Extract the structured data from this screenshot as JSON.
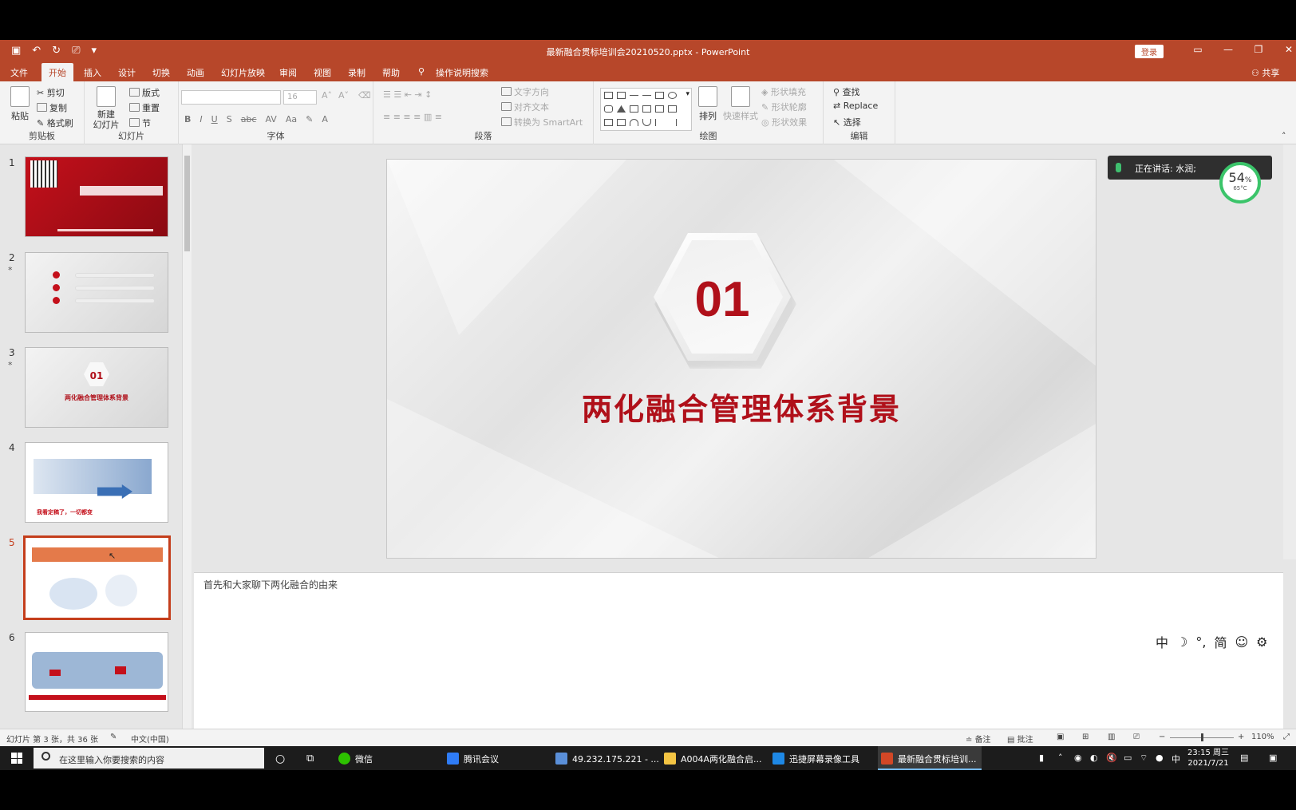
{
  "app": {
    "doc_title": "最新融合贯标培训会20210520.pptx  -  PowerPoint",
    "login_label": "登录",
    "share_label": "共享"
  },
  "ribbon_tabs": [
    "文件",
    "开始",
    "插入",
    "设计",
    "切换",
    "动画",
    "幻灯片放映",
    "审阅",
    "视图",
    "录制",
    "帮助"
  ],
  "active_tab": "开始",
  "search_hint": "操作说明搜索",
  "ribbon": {
    "clipboard": {
      "label": "剪贴板",
      "paste": "粘贴",
      "cut": "剪切",
      "copy": "复制",
      "format_painter": "格式刷"
    },
    "slides": {
      "label": "幻灯片",
      "new_slide": "新建",
      "new_slide2": "幻灯片",
      "layout": "版式",
      "reset": "重置",
      "section": "节"
    },
    "font": {
      "label": "字体",
      "size": "16"
    },
    "paragraph": {
      "label": "段落",
      "text_direction": "文字方向",
      "align_text": "对齐文本",
      "smartart": "转换为 SmartArt"
    },
    "drawing": {
      "label": "绘图",
      "arrange": "排列",
      "quick_styles": "快速样式",
      "shape_fill": "形状填充",
      "shape_outline": "形状轮廓",
      "shape_effects": "形状效果"
    },
    "editing": {
      "label": "编辑",
      "find": "查找",
      "replace": "Replace",
      "select": "选择"
    }
  },
  "thumbnails": {
    "numbers": [
      "1",
      "2",
      "3",
      "4",
      "5",
      "6"
    ],
    "thumb3": {
      "number": "01",
      "title": "两化融合管理体系背景"
    },
    "thumb4_footer": "我看定稿了，一切都变"
  },
  "slide": {
    "number": "01",
    "title": "两化融合管理体系背景"
  },
  "notes": "首先和大家聊下两化融合的由来",
  "overlay": {
    "speaking": "正在讲话: 水润;",
    "gauge_percent": "54",
    "gauge_unit": "%",
    "gauge_temp": "65°C"
  },
  "ime": [
    "中",
    "☽",
    "°,",
    "简",
    "☺",
    "⚙"
  ],
  "status": {
    "slide_info": "幻灯片 第 3 张，共 36 张",
    "language": "中文(中国)",
    "notes_btn": "备注",
    "comments_btn": "批注",
    "zoom": "110%"
  },
  "taskbar": {
    "search_placeholder": "在这里输入你要搜索的内容",
    "items": [
      "微信",
      "腾讯会议",
      "49.232.175.221 - ...",
      "A004A两化融合启...",
      "迅捷屏幕录像工具",
      "最新融合贯标培训..."
    ],
    "tray_lang": "中",
    "time": "23:15 周三",
    "date": "2021/7/21"
  }
}
